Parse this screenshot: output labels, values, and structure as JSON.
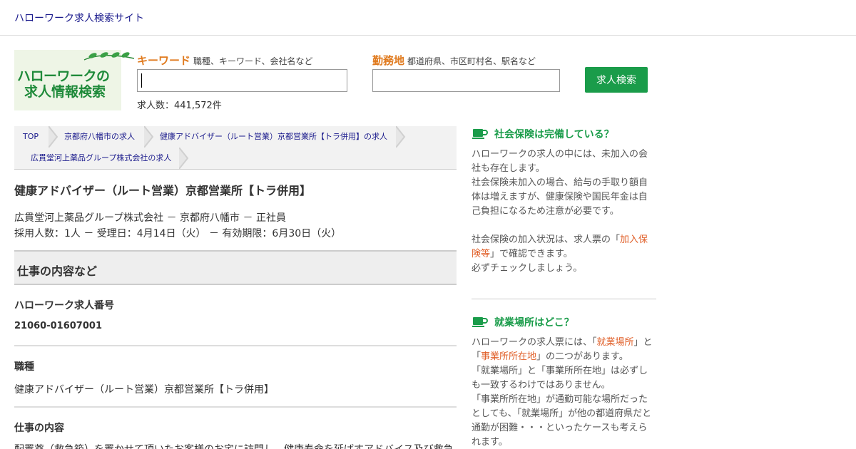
{
  "header": {
    "site_title": "ハローワーク求人検索サイト"
  },
  "logo": {
    "line1": "ハローワークの",
    "line2": "求人情報検索"
  },
  "search": {
    "keyword_label": "キーワード",
    "keyword_hint": "職種、キーワード、会社名など",
    "keyword_value": "",
    "location_label": "勤務地",
    "location_hint": "都道府県、市区町村名、駅名など",
    "location_value": "",
    "button_label": "求人検索",
    "count_text": "求人数：441,572件"
  },
  "breadcrumb": [
    "TOP",
    "京都府八幡市の求人",
    "健康アドバイザー（ルート営業）京都営業所【トラ併用】の求人",
    "広貫堂河上薬品グループ株式会社の求人"
  ],
  "job": {
    "title": "健康アドバイザー（ルート営業）京都営業所【トラ併用】",
    "meta1": "広貫堂河上薬品グループ株式会社 － 京都府八幡市 － 正社員",
    "meta2": "採用人数：1人 － 受理日：4月14日（火） － 有効期限：6月30日（火）",
    "section_title": "仕事の内容など",
    "number_label": "ハローワーク求人番号",
    "number_value": "21060-01607001",
    "occupation_label": "職種",
    "occupation_value": "健康アドバイザー（ルート営業）京都営業所【トラ併用】",
    "description_label": "仕事の内容",
    "description_value": "配置薬（救急箱）を置かせて頂いたお客様のお宅に訪問し、健康寿命を延ばすアドバイス及び救急"
  },
  "sidebar": {
    "box1": {
      "title": "社会保険は完備している？",
      "p1": "ハローワークの求人の中には、未加入の会社も存在します。",
      "p2": "社会保険未加入の場合、給与の手取り額自体は増えますが、健康保険や国民年金は自己負担になるため注意が必要です。",
      "p3_before": "社会保険の加入状況は、求人票の「",
      "p3_link": "加入保険等",
      "p3_after": "」で確認できます。",
      "p4": "必ずチェックしましょう。"
    },
    "box2": {
      "title": "就業場所はどこ？",
      "p1_a": "ハローワークの求人票には、「",
      "p1_link1": "就業場所",
      "p1_b": "」と「",
      "p1_link2": "事業所所在地",
      "p1_c": "」の二つがあります。",
      "p2": "「就業場所」と「事業所所在地」は必ずしも一致するわけではありません。",
      "p3": "「事業所所在地」が通勤可能な場所だったとしても、「就業場所」が他の都道府県だと通勤が困難・・・といったケースも考えられます。"
    }
  },
  "colors": {
    "accent_green": "#1a9c4a",
    "label_orange": "#e07a1e",
    "link_orange": "#e0602a",
    "link_blue": "#1a1a8c"
  },
  "icons": {
    "sidebar_heading": "coffee-cup-icon",
    "logo_decoration": "leaf-icon"
  }
}
